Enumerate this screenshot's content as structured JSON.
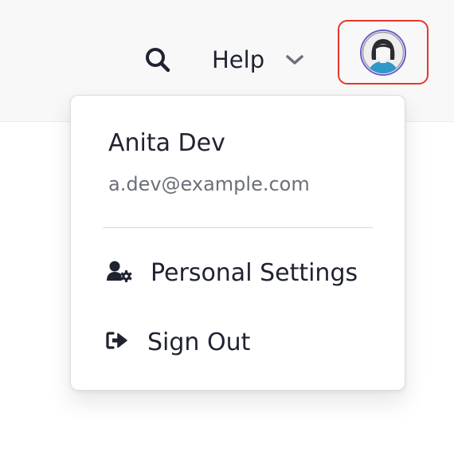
{
  "header": {
    "search_icon": "search-icon",
    "help_label": "Help",
    "help_chevron_icon": "chevron-down-icon",
    "avatar_icon": "user-avatar-icon",
    "avatar_highlight_color": "#e8352b"
  },
  "account_menu": {
    "user_name": "Anita Dev",
    "user_email": "a.dev@example.com",
    "items": [
      {
        "icon": "user-cog-icon",
        "label": "Personal Settings"
      },
      {
        "icon": "sign-out-icon",
        "label": "Sign Out"
      }
    ]
  }
}
